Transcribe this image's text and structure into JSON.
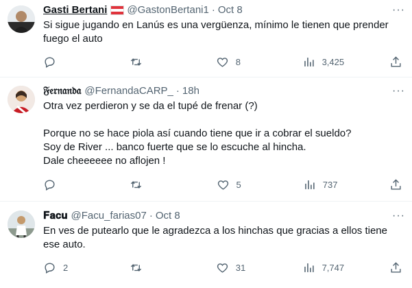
{
  "tweets": [
    {
      "name": "Gasti Bertani",
      "handle": "@GastonBertani1",
      "time": "Oct 8",
      "text": "Si sigue jugando en Lanús es una vergüenza, mínimo le tienen que prender fuego el auto",
      "replies": "",
      "retweets": "",
      "likes": "8",
      "views": "3,425"
    },
    {
      "name": "𝔉𝔢𝔯𝔫𝔞𝔫𝔡𝔞",
      "handle": "@FernandaCARP_",
      "time": "18h",
      "text": "Otra vez perdieron y se da el tupé de frenar (?)\n\nPorque no se hace piola así cuando tiene que ir a cobrar el sueldo?\nSoy de River ... banco fuerte que se lo escuche al hincha.\nDale cheeeeee no aflojen !",
      "replies": "",
      "retweets": "",
      "likes": "5",
      "views": "737"
    },
    {
      "name": "𝐅𝐚𝐜𝐮",
      "handle": "@Facu_farias07",
      "time": "Oct 8",
      "text": "En ves de putearlo que le agradezca a los hinchas que gracias a ellos tiene ese auto.",
      "replies": "2",
      "retweets": "",
      "likes": "31",
      "views": "7,747"
    }
  ],
  "icons": {
    "reply": "reply-icon",
    "retweet": "retweet-icon",
    "like": "heart-icon",
    "views": "views-icon",
    "share": "share-icon",
    "more": "more-icon"
  },
  "colors": {
    "secondary": "#536471",
    "divider": "#eff3f4",
    "flag_red": "#e0333c"
  }
}
